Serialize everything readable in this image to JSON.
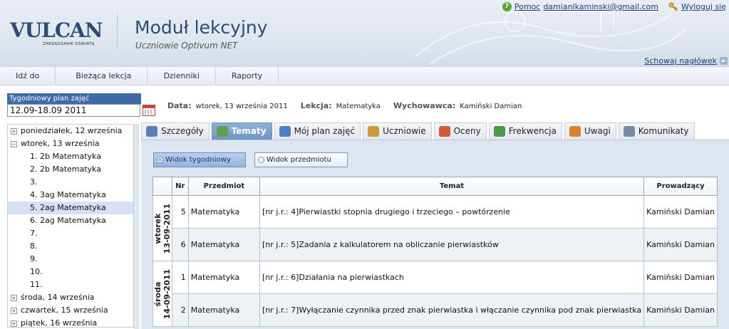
{
  "header": {
    "logo": "VULCAN",
    "logo_sub": "ZARZĄDZANIE OŚWIATĄ",
    "module_title": "Moduł lekcyjny",
    "module_subtitle": "Uczniowie Optivum NET",
    "help_label": "Pomoc",
    "user_email": "damianlkaminski@gmail.com",
    "logout_label": "Wyloguj się",
    "hide_header_label": "Schowaj nagłówek"
  },
  "menu": [
    "Idź do",
    "Bieżąca lekcja",
    "Dzienniki",
    "Raporty"
  ],
  "sidebar": {
    "week_label": "Tygodniowy plan zajęć",
    "week_value": "12.09-18.09 2011",
    "tree": [
      {
        "type": "day",
        "label": "poniedziałek, 12 września",
        "toggle": "+"
      },
      {
        "type": "day",
        "label": "wtorek, 13 września",
        "toggle": "-"
      },
      {
        "type": "lesson",
        "label": "1. 2b Matematyka"
      },
      {
        "type": "lesson",
        "label": "2. 2b Matematyka"
      },
      {
        "type": "lesson",
        "label": "3."
      },
      {
        "type": "lesson",
        "label": "4. 3ag Matematyka"
      },
      {
        "type": "lesson",
        "label": "5. 2ag Matematyka",
        "selected": true
      },
      {
        "type": "lesson",
        "label": "6. 2ag Matematyka"
      },
      {
        "type": "lesson",
        "label": "7."
      },
      {
        "type": "lesson",
        "label": "8."
      },
      {
        "type": "lesson",
        "label": "9."
      },
      {
        "type": "lesson",
        "label": "10."
      },
      {
        "type": "lesson",
        "label": "11."
      },
      {
        "type": "day",
        "label": "środa, 14 września",
        "toggle": "+"
      },
      {
        "type": "day",
        "label": "czwartek, 15 września",
        "toggle": "+"
      },
      {
        "type": "day",
        "label": "piątek, 16 września",
        "toggle": "+"
      }
    ]
  },
  "info": {
    "date_label": "Data:",
    "date_value": "wtorek, 13 września 2011",
    "lesson_label": "Lekcja:",
    "lesson_value": "Matematyka",
    "tutor_label": "Wychowawca:",
    "tutor_value": "Kamiński Damian"
  },
  "tabs": [
    {
      "label": "Szczegóły",
      "icon": "magnifier-icon",
      "color": "#5a7fb0"
    },
    {
      "label": "Tematy",
      "icon": "topics-icon",
      "color": "#5e9f4e",
      "active": true
    },
    {
      "label": "Mój plan zajęć",
      "icon": "schedule-icon",
      "color": "#4c7fc0"
    },
    {
      "label": "Uczniowie",
      "icon": "students-icon",
      "color": "#c89a3a"
    },
    {
      "label": "Oceny",
      "icon": "grades-icon",
      "color": "#d05a3a"
    },
    {
      "label": "Frekwencja",
      "icon": "attendance-icon",
      "color": "#4a9a4a"
    },
    {
      "label": "Uwagi",
      "icon": "remarks-icon",
      "color": "#d9822b"
    },
    {
      "label": "Komunikaty",
      "icon": "megaphone-icon",
      "color": "#7a8aa0"
    }
  ],
  "view_buttons": {
    "weekly": "Widok tygodniowy",
    "subject": "Widok przedmiotu"
  },
  "table": {
    "columns": {
      "nr": "Nr",
      "subject": "Przedmiot",
      "topic": "Temat",
      "teacher": "Prowadzący"
    },
    "groups": [
      {
        "date_line1": "wtorek",
        "date_line2": "13-09-2011",
        "rows": [
          {
            "nr": "5",
            "subject": "Matematyka",
            "topic": " [nr j.r.: 4]Pierwiastki stopnia drugiego i trzeciego – powtórzenie",
            "teacher": "Kamiński Damian"
          },
          {
            "nr": "6",
            "subject": "Matematyka",
            "topic": "[nr j.r.: 5]Zadania z kalkulatorem na obliczanie pierwiastków",
            "teacher": "Kamiński Damian"
          }
        ]
      },
      {
        "date_line1": "środa",
        "date_line2": "14-09-2011",
        "rows": [
          {
            "nr": "1",
            "subject": "Matematyka",
            "topic": "[nr j.r.: 6]Działania na pierwiastkach",
            "teacher": "Kamiński Damian"
          },
          {
            "nr": "2",
            "subject": "Matematyka",
            "topic": "[nr j.r.: 7]Wyłączanie czynnika przed znak pierwiastka i włączanie czynnika pod znak pierwiastka",
            "teacher": "Kamiński Damian"
          }
        ]
      }
    ]
  }
}
